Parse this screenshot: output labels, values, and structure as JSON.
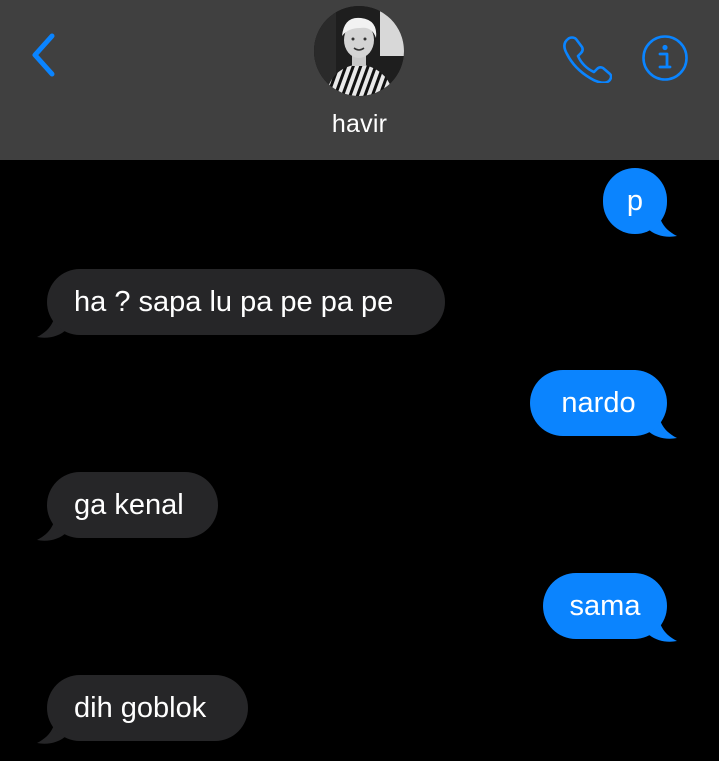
{
  "header": {
    "contact_name": "havir",
    "back_icon": "chevron-left-icon",
    "call_icon": "phone-icon",
    "info_icon": "info-icon"
  },
  "messages": [
    {
      "direction": "sent",
      "text": "p"
    },
    {
      "direction": "received",
      "text": "ha ? sapa lu pa pe pa pe"
    },
    {
      "direction": "sent",
      "text": "nardo"
    },
    {
      "direction": "received",
      "text": "ga kenal"
    },
    {
      "direction": "sent",
      "text": "sama"
    },
    {
      "direction": "received",
      "text": "dih goblok"
    }
  ],
  "colors": {
    "header_bg": "#404040",
    "thread_bg": "#000000",
    "sent_bubble": "#0b84fe",
    "received_bubble": "#262628",
    "accent": "#0a84ff",
    "text": "#ffffff"
  }
}
